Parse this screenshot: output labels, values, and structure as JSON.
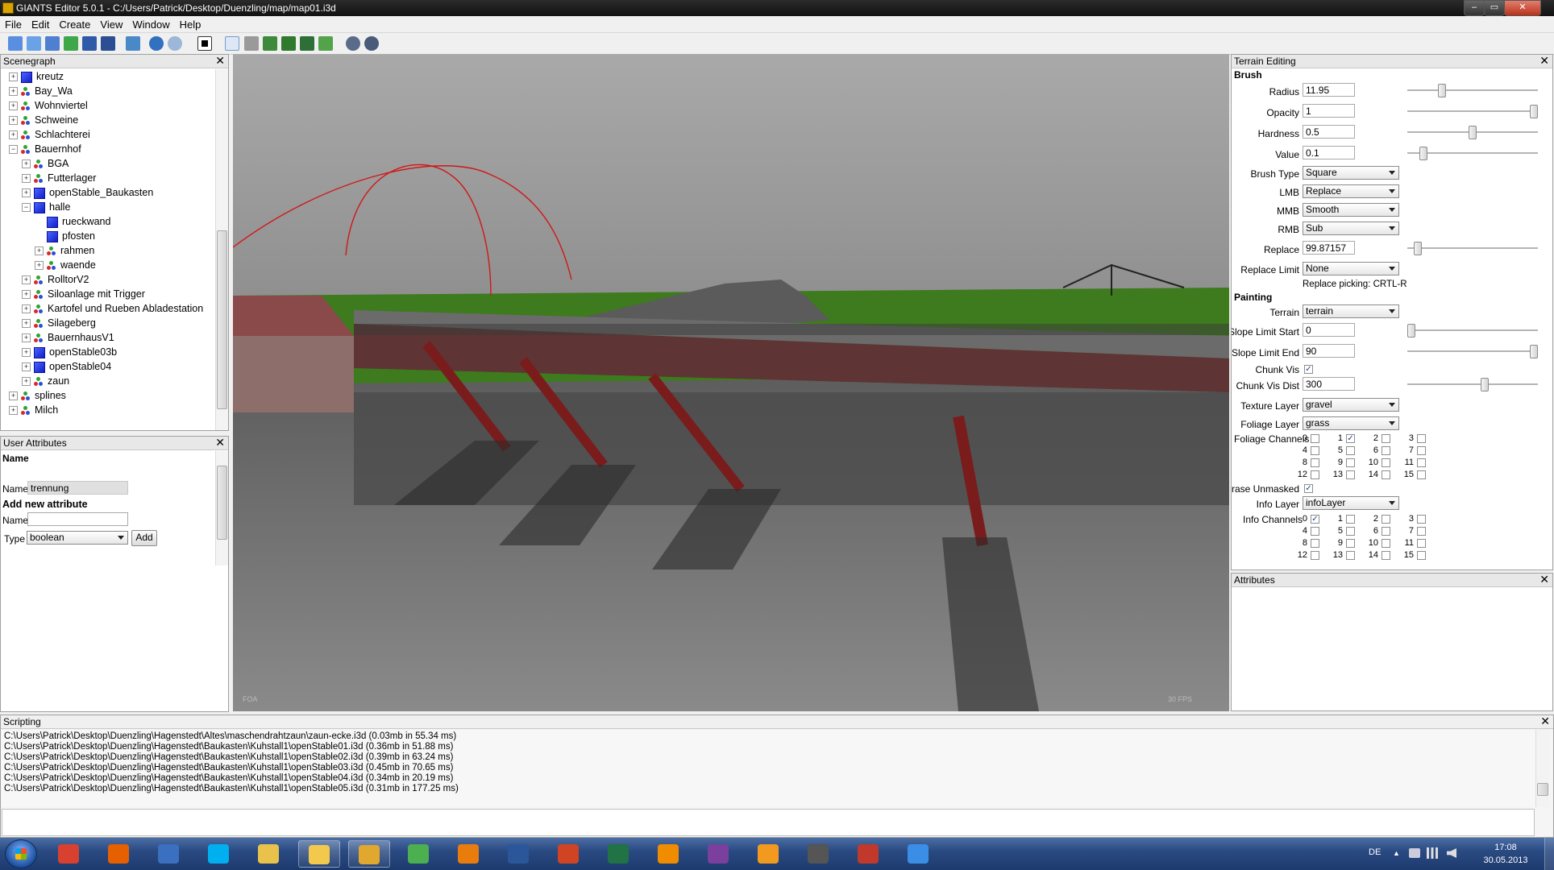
{
  "window": {
    "title": "GIANTS Editor 5.0.1 - C:/Users/Patrick/Desktop/Duenzling/map/map01.i3d",
    "minimize": "‒",
    "maximize": "▭",
    "close": "✕"
  },
  "menu": [
    "File",
    "Edit",
    "Create",
    "View",
    "Window",
    "Help"
  ],
  "toolbar_icons": [
    "new-icon",
    "open-icon",
    "import-icon",
    "reload-icon",
    "save-icon",
    "save-all-icon",
    "refresh-icon",
    "undo-icon",
    "redo-icon",
    "stop-icon",
    "select-icon",
    "move-icon",
    "terrain-sculpt-icon",
    "terrain-paint-icon",
    "terrain-smooth-icon",
    "foliage-paint-icon",
    "settings-icon",
    "debug-icon"
  ],
  "scenegraph": {
    "title": "Scenegraph",
    "close": "✕",
    "items": [
      {
        "label": "kreutz",
        "icon": "cube",
        "indent": 0,
        "exp": "+"
      },
      {
        "label": "Bay_Wa",
        "icon": "transformgroup",
        "indent": 0,
        "exp": "+"
      },
      {
        "label": "Wohnviertel",
        "icon": "transformgroup",
        "indent": 0,
        "exp": "+"
      },
      {
        "label": "Schweine",
        "icon": "transformgroup",
        "indent": 0,
        "exp": "+"
      },
      {
        "label": "Schlachterei",
        "icon": "transformgroup",
        "indent": 0,
        "exp": "+"
      },
      {
        "label": "Bauernhof",
        "icon": "transformgroup",
        "indent": 0,
        "exp": "−"
      },
      {
        "label": "BGA",
        "icon": "transformgroup",
        "indent": 1,
        "exp": "+"
      },
      {
        "label": "Futterlager",
        "icon": "transformgroup",
        "indent": 1,
        "exp": "+"
      },
      {
        "label": "openStable_Baukasten",
        "icon": "cube",
        "indent": 1,
        "exp": "+"
      },
      {
        "label": "halle",
        "icon": "cube",
        "indent": 1,
        "exp": "−"
      },
      {
        "label": "rueckwand",
        "icon": "cube",
        "indent": 2,
        "exp": ""
      },
      {
        "label": "pfosten",
        "icon": "cube",
        "indent": 2,
        "exp": ""
      },
      {
        "label": "rahmen",
        "icon": "transformgroup",
        "indent": 2,
        "exp": "+"
      },
      {
        "label": "waende",
        "icon": "transformgroup",
        "indent": 2,
        "exp": "+"
      },
      {
        "label": "RolltorV2",
        "icon": "transformgroup",
        "indent": 1,
        "exp": "+"
      },
      {
        "label": "Siloanlage mit Trigger",
        "icon": "transformgroup",
        "indent": 1,
        "exp": "+"
      },
      {
        "label": "Kartofel und Rueben Abladestation",
        "icon": "transformgroup",
        "indent": 1,
        "exp": "+"
      },
      {
        "label": "Silageberg",
        "icon": "transformgroup",
        "indent": 1,
        "exp": "+"
      },
      {
        "label": "BauernhausV1",
        "icon": "transformgroup",
        "indent": 1,
        "exp": "+"
      },
      {
        "label": "openStable03b",
        "icon": "cube",
        "indent": 1,
        "exp": "+"
      },
      {
        "label": "openStable04",
        "icon": "cube",
        "indent": 1,
        "exp": "+"
      },
      {
        "label": "zaun",
        "icon": "transformgroup",
        "indent": 1,
        "exp": "+"
      },
      {
        "label": "splines",
        "icon": "transformgroup",
        "indent": 0,
        "exp": "+"
      },
      {
        "label": "Milch",
        "icon": "transformgroup",
        "indent": 0,
        "exp": "+"
      }
    ]
  },
  "user_attributes": {
    "title": "User Attributes",
    "close": "✕",
    "section_name": "Name",
    "name_label": "Name",
    "name_value": "trennung",
    "add_heading": "Add new attribute",
    "new_name_label": "Name",
    "new_name_value": "",
    "type_label": "Type",
    "type_value": "boolean",
    "add_button": "Add"
  },
  "viewport": {
    "corner_left": "FOA",
    "corner_right": "30 FPS"
  },
  "terrain_editing": {
    "title": "Terrain Editing",
    "close": "✕",
    "brush_heading": "Brush",
    "radius_label": "Radius",
    "radius_value": "11.95",
    "radius_level": 0.25,
    "opacity_label": "Opacity",
    "opacity_value": "1",
    "opacity_level": 1.0,
    "hardness_label": "Hardness",
    "hardness_value": "0.5",
    "hardness_level": 0.5,
    "value_label": "Value",
    "value_value": "0.1",
    "value_level": 0.1,
    "brush_type_label": "Brush Type",
    "brush_type_value": "Square",
    "lmb_label": "LMB",
    "lmb_value": "Replace",
    "mmb_label": "MMB",
    "mmb_value": "Smooth",
    "rmb_label": "RMB",
    "rmb_value": "Sub",
    "replace_label": "Replace",
    "replace_value": "99.87157",
    "replace_level": 0.05,
    "replace_limit_label": "Replace Limit",
    "replace_limit_value": "None",
    "replace_picking": "Replace picking: CRTL-R",
    "painting_heading": "Painting",
    "terrain_label": "Terrain",
    "terrain_value": "terrain",
    "slope_start_label": "Slope Limit Start",
    "slope_start_value": "0",
    "slope_start_level": 0.0,
    "slope_end_label": "Slope Limit End",
    "slope_end_value": "90",
    "slope_end_level": 1.0,
    "chunk_vis_label": "Chunk Vis",
    "chunk_vis_checked": "✓",
    "chunk_vis_dist_label": "Chunk Vis Dist",
    "chunk_vis_dist_value": "300",
    "chunk_vis_dist_level": 0.6,
    "texture_layer_label": "Texture Layer",
    "texture_layer_value": "gravel",
    "foliage_layer_label": "Foliage Layer",
    "foliage_layer_value": "grass",
    "foliage_channels_label": "Foliage Channels",
    "foliage_channels": [
      {
        "n": "0",
        "checked": ""
      },
      {
        "n": "1",
        "checked": "✓"
      },
      {
        "n": "2",
        "checked": ""
      },
      {
        "n": "3",
        "checked": ""
      },
      {
        "n": "4",
        "checked": ""
      },
      {
        "n": "5",
        "checked": ""
      },
      {
        "n": "6",
        "checked": ""
      },
      {
        "n": "7",
        "checked": ""
      },
      {
        "n": "8",
        "checked": ""
      },
      {
        "n": "9",
        "checked": ""
      },
      {
        "n": "10",
        "checked": ""
      },
      {
        "n": "11",
        "checked": ""
      },
      {
        "n": "12",
        "checked": ""
      },
      {
        "n": "13",
        "checked": ""
      },
      {
        "n": "14",
        "checked": ""
      },
      {
        "n": "15",
        "checked": ""
      }
    ],
    "erase_unmasked_label": "Erase Unmasked",
    "erase_unmasked_checked": "✓",
    "info_layer_label": "Info Layer",
    "info_layer_value": "infoLayer",
    "info_channels_label": "Info Channels",
    "info_channels": [
      {
        "n": "0",
        "checked": "✓"
      },
      {
        "n": "1",
        "checked": ""
      },
      {
        "n": "2",
        "checked": ""
      },
      {
        "n": "3",
        "checked": ""
      },
      {
        "n": "4",
        "checked": ""
      },
      {
        "n": "5",
        "checked": ""
      },
      {
        "n": "6",
        "checked": ""
      },
      {
        "n": "7",
        "checked": ""
      },
      {
        "n": "8",
        "checked": ""
      },
      {
        "n": "9",
        "checked": ""
      },
      {
        "n": "10",
        "checked": ""
      },
      {
        "n": "11",
        "checked": ""
      },
      {
        "n": "12",
        "checked": ""
      },
      {
        "n": "13",
        "checked": ""
      },
      {
        "n": "14",
        "checked": ""
      },
      {
        "n": "15",
        "checked": ""
      }
    ]
  },
  "attributes": {
    "title": "Attributes",
    "close": "✕"
  },
  "scripting": {
    "title": "Scripting",
    "close": "✕",
    "lines": [
      "C:\\Users\\Patrick\\Desktop\\Duenzling\\Hagenstedt\\Altes\\maschendrahtzaun\\zaun-ecke.i3d (0.03mb in 55.34 ms)",
      "C:\\Users\\Patrick\\Desktop\\Duenzling\\Hagenstedt\\Baukasten\\Kuhstall1\\openStable01.i3d (0.36mb in 51.88 ms)",
      "C:\\Users\\Patrick\\Desktop\\Duenzling\\Hagenstedt\\Baukasten\\Kuhstall1\\openStable02.i3d (0.39mb in 63.24 ms)",
      "C:\\Users\\Patrick\\Desktop\\Duenzling\\Hagenstedt\\Baukasten\\Kuhstall1\\openStable03.i3d (0.45mb in 70.65 ms)",
      "C:\\Users\\Patrick\\Desktop\\Duenzling\\Hagenstedt\\Baukasten\\Kuhstall1\\openStable04.i3d (0.34mb in 20.19 ms)",
      "C:\\Users\\Patrick\\Desktop\\Duenzling\\Hagenstedt\\Baukasten\\Kuhstall1\\openStable05.i3d (0.31mb in 177.25 ms)"
    ],
    "input_value": ""
  },
  "taskbar": {
    "apps": [
      {
        "name": "chrome-icon",
        "color": "#d8402f"
      },
      {
        "name": "firefox-icon",
        "color": "#e66000"
      },
      {
        "name": "thunderbird-icon",
        "color": "#3b6fbf"
      },
      {
        "name": "skype-icon",
        "color": "#00aff0"
      },
      {
        "name": "paint-icon",
        "color": "#e8c24a"
      },
      {
        "name": "explorer-icon",
        "color": "#f2c94c"
      },
      {
        "name": "giants-editor-icon",
        "color": "#e0a82e"
      },
      {
        "name": "chart-tool-icon",
        "color": "#4caf50"
      },
      {
        "name": "blender-icon",
        "color": "#e87d0d"
      },
      {
        "name": "word-icon",
        "color": "#2b579a"
      },
      {
        "name": "powerpoint-icon",
        "color": "#d04423"
      },
      {
        "name": "excel-icon",
        "color": "#217346"
      },
      {
        "name": "vlc-icon",
        "color": "#f08c00"
      },
      {
        "name": "winrar-icon",
        "color": "#7b3f9e"
      },
      {
        "name": "media-player-icon",
        "color": "#f29a1f"
      },
      {
        "name": "tractor-icon",
        "color": "#555555"
      },
      {
        "name": "farming-sim-icon",
        "color": "#c0392b"
      },
      {
        "name": "itunes-icon",
        "color": "#3a8ee6"
      }
    ],
    "lang": "DE",
    "time": "17:08",
    "date": "30.05.2013"
  }
}
